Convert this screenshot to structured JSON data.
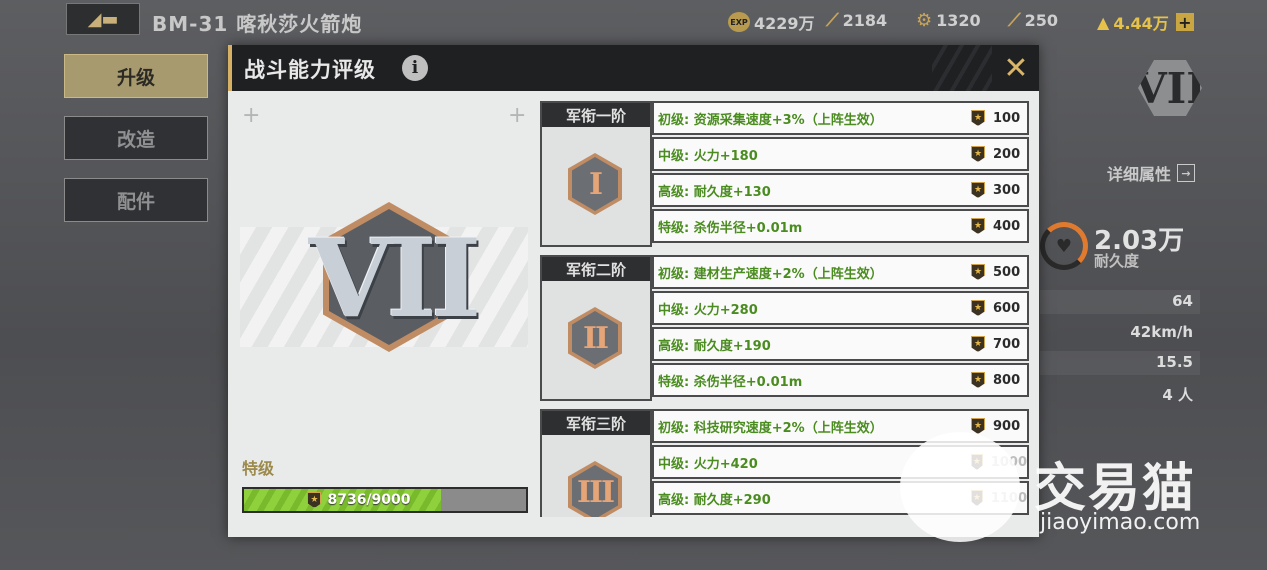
{
  "header": {
    "unit_title": "BM-31 喀秋莎火箭炮",
    "resources": [
      {
        "icon": "exp-icon",
        "value": "4229万"
      },
      {
        "icon": "fuel-icon",
        "value": "2184"
      },
      {
        "icon": "gear-icon",
        "value": "1320"
      },
      {
        "icon": "shell-icon",
        "value": "250"
      },
      {
        "icon": "gold-icon",
        "value": "4.44万",
        "color": "#e6c24a"
      }
    ],
    "exp_badge": "EXP"
  },
  "tabs": [
    {
      "label": "升级",
      "active": true
    },
    {
      "label": "改造",
      "active": false
    },
    {
      "label": "配件",
      "active": false
    }
  ],
  "right_panel": {
    "detail_label": "详细属性",
    "rank_glyph": "VII",
    "durability_value": "2.03万",
    "durability_label": "耐久度",
    "stats": [
      "64",
      "42km/h",
      "15.5",
      "4 人"
    ]
  },
  "modal": {
    "title": "战斗能力评级",
    "info_glyph": "i",
    "close_glyph": "✕",
    "current_rank_glyph": "VII",
    "grade_label": "特级",
    "progress": {
      "current": 8736,
      "max": 9000,
      "text": "8736/9000"
    },
    "tiers": [
      {
        "name": "军衔一阶",
        "glyph": "I",
        "rows": [
          {
            "text": "初级: 资源采集速度+3%（上阵生效）",
            "cost": "100"
          },
          {
            "text": "中级: 火力+180",
            "cost": "200"
          },
          {
            "text": "高级: 耐久度+130",
            "cost": "300"
          },
          {
            "text": "特级: 杀伤半径+0.01m",
            "cost": "400"
          }
        ]
      },
      {
        "name": "军衔二阶",
        "glyph": "II",
        "rows": [
          {
            "text": "初级: 建材生产速度+2%（上阵生效）",
            "cost": "500"
          },
          {
            "text": "中级: 火力+280",
            "cost": "600"
          },
          {
            "text": "高级: 耐久度+190",
            "cost": "700"
          },
          {
            "text": "特级: 杀伤半径+0.01m",
            "cost": "800"
          }
        ]
      },
      {
        "name": "军衔三阶",
        "glyph": "III",
        "rows": [
          {
            "text": "初级: 科技研究速度+2%（上阵生效）",
            "cost": "900"
          },
          {
            "text": "中级: 火力+420",
            "cost": "1000"
          },
          {
            "text": "高级: 耐久度+290",
            "cost": "1100"
          }
        ]
      }
    ]
  },
  "watermark": {
    "text": "交易猫",
    "sub": "jiaoyimao.com"
  },
  "colors": {
    "accent": "#d6b064",
    "progress": "#8fd13c",
    "bonus_text": "#4a8c1f",
    "rank_border": "#c08c64"
  }
}
